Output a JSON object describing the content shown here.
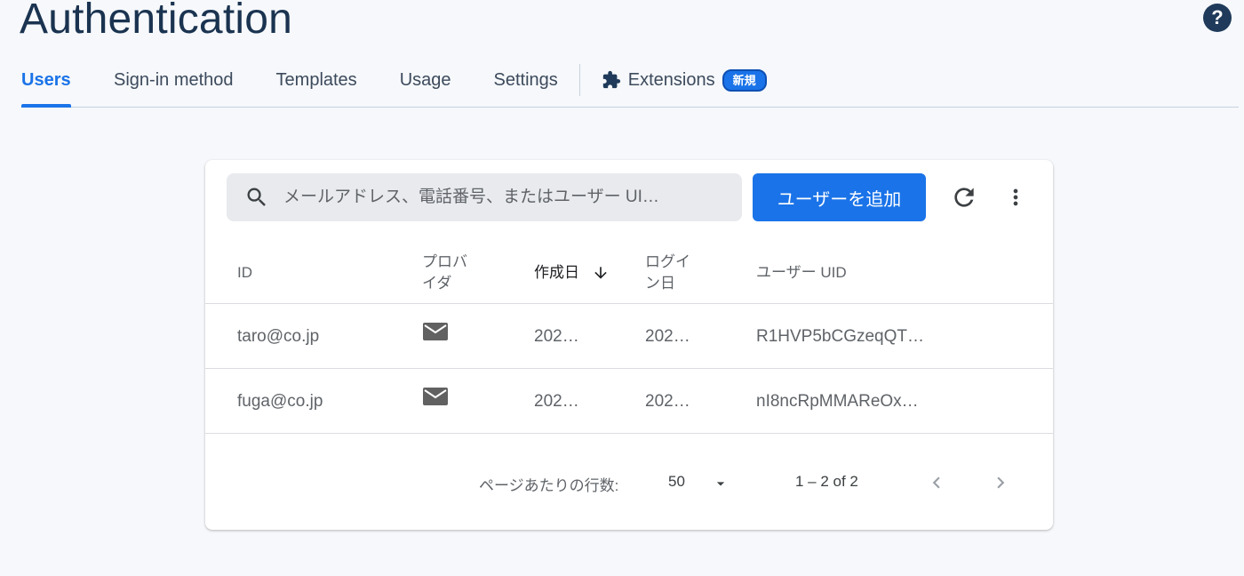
{
  "header": {
    "title": "Authentication",
    "help_symbol": "?"
  },
  "tabs": [
    {
      "label": "Users",
      "active": true
    },
    {
      "label": "Sign-in method"
    },
    {
      "label": "Templates"
    },
    {
      "label": "Usage"
    },
    {
      "label": "Settings"
    },
    {
      "label": "Extensions",
      "badge": "新規"
    }
  ],
  "toolbar": {
    "search_placeholder": "メールアドレス、電話番号、またはユーザー UI…",
    "add_user_label": "ユーザーを追加"
  },
  "table": {
    "columns": {
      "id": "ID",
      "provider_line1": "プロバ",
      "provider_line2": "イダ",
      "created": "作成日",
      "login_line1": "ログイ",
      "login_line2": "ン日",
      "uid": "ユーザー UID"
    },
    "rows": [
      {
        "id": "taro@co.jp",
        "provider": "mail-icon",
        "created": "202…",
        "login": "202…",
        "uid": "R1HVP5bCGzeqQT…"
      },
      {
        "id": "fuga@co.jp",
        "provider": "mail-icon",
        "created": "202…",
        "login": "202…",
        "uid": "nI8ncRpMMAReOx…"
      }
    ]
  },
  "pagination": {
    "rows_per_page_label": "ページあたりの行数:",
    "rows_per_page_value": "50",
    "range": "1 – 2 of 2"
  },
  "colors": {
    "accent": "#1a73e8",
    "title": "#1a3350",
    "background": "#f6f8fb"
  }
}
